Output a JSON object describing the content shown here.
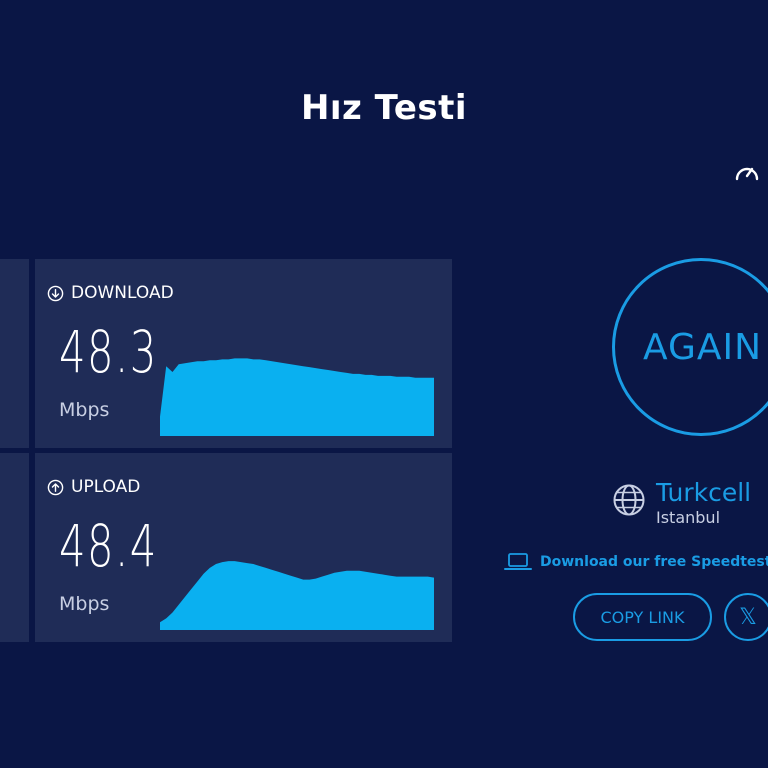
{
  "page": {
    "title": "Hız Testi"
  },
  "header": {
    "gauge_icon": "gauge-icon",
    "gauge_text": ""
  },
  "download": {
    "label": "DOWNLOAD",
    "icon": "arrow-down-circle-icon",
    "value": "48.3",
    "unit": "Mbps"
  },
  "upload": {
    "label": "UPLOAD",
    "icon": "arrow-up-circle-icon",
    "value": "48.4",
    "unit": "Mbps"
  },
  "actions": {
    "again_label": "AGAIN",
    "copy_link_label": "COPY LINK",
    "x_label": "𝕏"
  },
  "isp": {
    "name": "Turkcell",
    "city": "Istanbul",
    "icon": "globe-icon"
  },
  "app_link": {
    "label": "Download our free Speedtest",
    "icon": "laptop-icon"
  },
  "colors": {
    "background": "#0a1645",
    "panel": "#1f2c57",
    "accent": "#1a9ce4",
    "graph_fill": "#0ab0f0"
  },
  "chart_data": [
    {
      "type": "area",
      "series": [
        {
          "values": [
            20,
            72,
            66,
            74,
            75,
            76,
            77,
            77,
            78,
            78,
            79,
            79,
            80,
            80,
            80,
            79,
            79,
            78,
            77,
            76,
            75,
            74,
            73,
            72,
            71,
            70,
            69,
            68,
            67,
            66,
            65,
            64,
            64,
            63,
            63,
            62,
            62,
            62,
            61,
            61,
            61,
            60,
            60,
            60,
            60
          ]
        }
      ],
      "ylim": [
        0,
        100
      ]
    },
    {
      "type": "area",
      "series": [
        {
          "values": [
            8,
            12,
            18,
            26,
            34,
            42,
            50,
            58,
            64,
            68,
            70,
            71,
            71,
            70,
            69,
            68,
            66,
            64,
            62,
            60,
            58,
            56,
            54,
            52,
            52,
            53,
            55,
            57,
            59,
            60,
            61,
            61,
            61,
            60,
            59,
            58,
            57,
            56,
            55,
            55,
            55,
            55,
            55,
            55,
            54
          ]
        }
      ],
      "ylim": [
        0,
        100
      ]
    }
  ]
}
